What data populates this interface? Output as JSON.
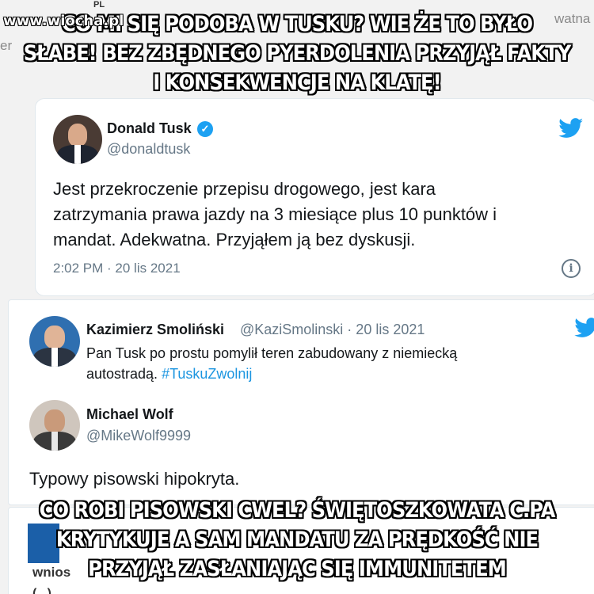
{
  "watermark": "www.wiocha.pl",
  "background_fragments": {
    "top_right": "watna",
    "top_left": "er",
    "top_small": "PL",
    "bottom_left": "wnios",
    "bottom_edge": "(...)"
  },
  "caption_top": {
    "line1": "CO MI SIĘ PODOBA W TUSKU? WIE ŻE TO BYŁO",
    "line2": "SŁABE! BEZ ZBĘDNEGO PYERDOLENIA PRZYJĄŁ FAKTY",
    "line3": "I KONSEKWENCJE NA KLATĘ!"
  },
  "caption_bottom": {
    "line1": "CO ROBI PISOWSKI CWEL? ŚWIĘTOSZKOWATA C.PA",
    "line2": "KRYTYKUJE A SAM MANDATU ZA PRĘDKOŚĆ NIE",
    "line3": "PRZYJĄŁ ZASŁANIAJĄC SIĘ IMMUNITETEM"
  },
  "tweet_main": {
    "author_name": "Donald Tusk",
    "author_handle": "@donaldtusk",
    "body_line1": "Jest przekroczenie przepisu drogowego, jest kara",
    "body_line2": "zatrzymania prawa jazdy na 3 miesiące plus 10 punktów i",
    "body_line3": "mandat. Adekwatna. Przyjąłem ją bez dyskusji.",
    "timestamp": "2:02 PM · 20 lis 2021"
  },
  "tweet_reply_1": {
    "author_name": "Kazimierz Smoliński",
    "author_handle": "@KaziSmolinski · 20 lis 2021",
    "body_line1": "Pan Tusk po prostu pomylił teren zabudowany z niemiecką",
    "body_line2_text": "autostradą. ",
    "body_line2_hashtag": "#TuskuZwolnij"
  },
  "tweet_reply_2": {
    "author_name": "Michael Wolf",
    "author_handle": "@MikeWolf9999",
    "body": "Typowy pisowski hipokryta."
  },
  "colors": {
    "twitter_blue": "#1da1f2",
    "hashtag_blue": "#1b95e0",
    "muted_text": "#657786"
  },
  "icons": {
    "verified": "verified-badge-icon",
    "twitter": "twitter-bird-icon",
    "info": "info-icon"
  }
}
